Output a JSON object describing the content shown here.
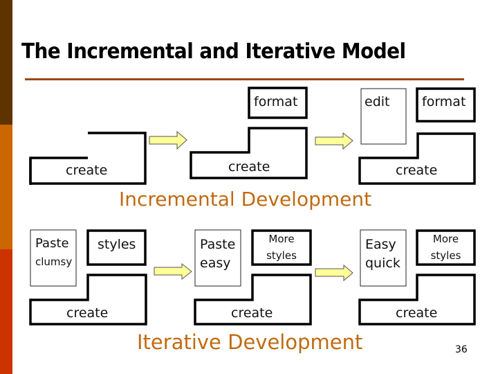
{
  "slide": {
    "title": "The Incremental and Iterative Model",
    "page_number": "36",
    "colors": {
      "sidebar_top": "#5f3300",
      "sidebar_middle": "#cc6600",
      "sidebar_bottom": "#cc3300",
      "title_rule": "#a0441e",
      "section_heading": "#c06a10",
      "arrow_fill": "#ffff99"
    }
  },
  "incremental": {
    "heading": "Incremental Development",
    "stages": [
      {
        "create": "create"
      },
      {
        "create": "create",
        "format": "format"
      },
      {
        "create": "create",
        "format": "format",
        "edit": "edit"
      }
    ]
  },
  "iterative": {
    "heading": "Iterative Development",
    "stages": [
      {
        "create": "create",
        "styles": "styles",
        "paste_line1": "Paste",
        "paste_line2": "clumsy"
      },
      {
        "create": "create",
        "styles_line1": "More",
        "styles_line2": "styles",
        "paste_line1": "Paste",
        "paste_line2": "easy"
      },
      {
        "create": "create",
        "styles_line1": "More",
        "styles_line2": "styles",
        "paste_line1": "Easy",
        "paste_line2": "quick"
      }
    ]
  },
  "icons": {
    "arrow": "right-arrow-icon"
  }
}
